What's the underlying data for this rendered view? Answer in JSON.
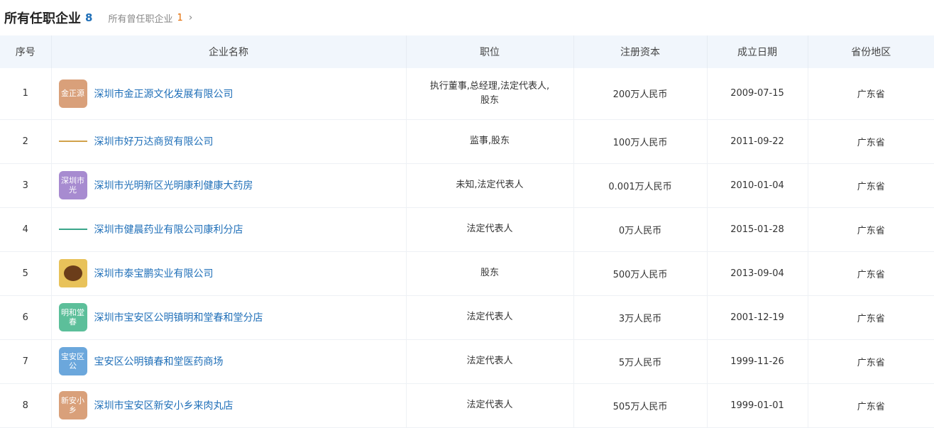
{
  "header": {
    "title": "所有任职企业",
    "count": "8",
    "sub_label": "所有曾任职企业",
    "sub_count": "1",
    "chevron": "›"
  },
  "columns": [
    "序号",
    "企业名称",
    "职位",
    "注册资本",
    "成立日期",
    "省份地区"
  ],
  "rows": [
    {
      "no": "1",
      "logo": {
        "text": "金正源",
        "color": "#d9a07a",
        "style": "box"
      },
      "name": "深圳市金正源文化发展有限公司",
      "position_lines": [
        "执行董事,总经理,法定代表人,",
        "股东"
      ],
      "capital": "200万人民币",
      "date": "2009-07-15",
      "region": "广东省"
    },
    {
      "no": "2",
      "logo": {
        "text": "",
        "color": "#d1a24a",
        "style": "line-gold"
      },
      "name": "深圳市好万达商贸有限公司",
      "position_lines": [
        "监事,股东"
      ],
      "capital": "100万人民币",
      "date": "2011-09-22",
      "region": "广东省"
    },
    {
      "no": "3",
      "logo": {
        "text": "深圳市光",
        "color": "#a78bd0",
        "style": "box"
      },
      "name": "深圳市光明新区光明康利健康大药房",
      "position_lines": [
        "未知,法定代表人"
      ],
      "capital": "0.001万人民币",
      "date": "2010-01-04",
      "region": "广东省"
    },
    {
      "no": "4",
      "logo": {
        "text": "",
        "color": "#3aa58a",
        "style": "line-teal"
      },
      "name": "深圳市健晨药业有限公司康利分店",
      "position_lines": [
        "法定代表人"
      ],
      "capital": "0万人民币",
      "date": "2015-01-28",
      "region": "广东省"
    },
    {
      "no": "5",
      "logo": {
        "text": "",
        "color": "#e8c25a",
        "style": "emblem"
      },
      "name": "深圳市泰宝鹏实业有限公司",
      "position_lines": [
        "股东"
      ],
      "capital": "500万人民币",
      "date": "2013-09-04",
      "region": "广东省"
    },
    {
      "no": "6",
      "logo": {
        "text": "明和堂春",
        "color": "#5cbf9a",
        "style": "box"
      },
      "name": "深圳市宝安区公明镇明和堂春和堂分店",
      "position_lines": [
        "法定代表人"
      ],
      "capital": "3万人民币",
      "date": "2001-12-19",
      "region": "广东省"
    },
    {
      "no": "7",
      "logo": {
        "text": "宝安区公",
        "color": "#6ba7dc",
        "style": "box"
      },
      "name": "宝安区公明镇春和堂医药商场",
      "position_lines": [
        "法定代表人"
      ],
      "capital": "5万人民币",
      "date": "1999-11-26",
      "region": "广东省"
    },
    {
      "no": "8",
      "logo": {
        "text": "新安小乡",
        "color": "#d9a07a",
        "style": "box"
      },
      "name": "深圳市宝安区新安小乡来肉丸店",
      "position_lines": [
        "法定代表人"
      ],
      "capital": "505万人民币",
      "date": "1999-01-01",
      "region": "广东省"
    }
  ]
}
